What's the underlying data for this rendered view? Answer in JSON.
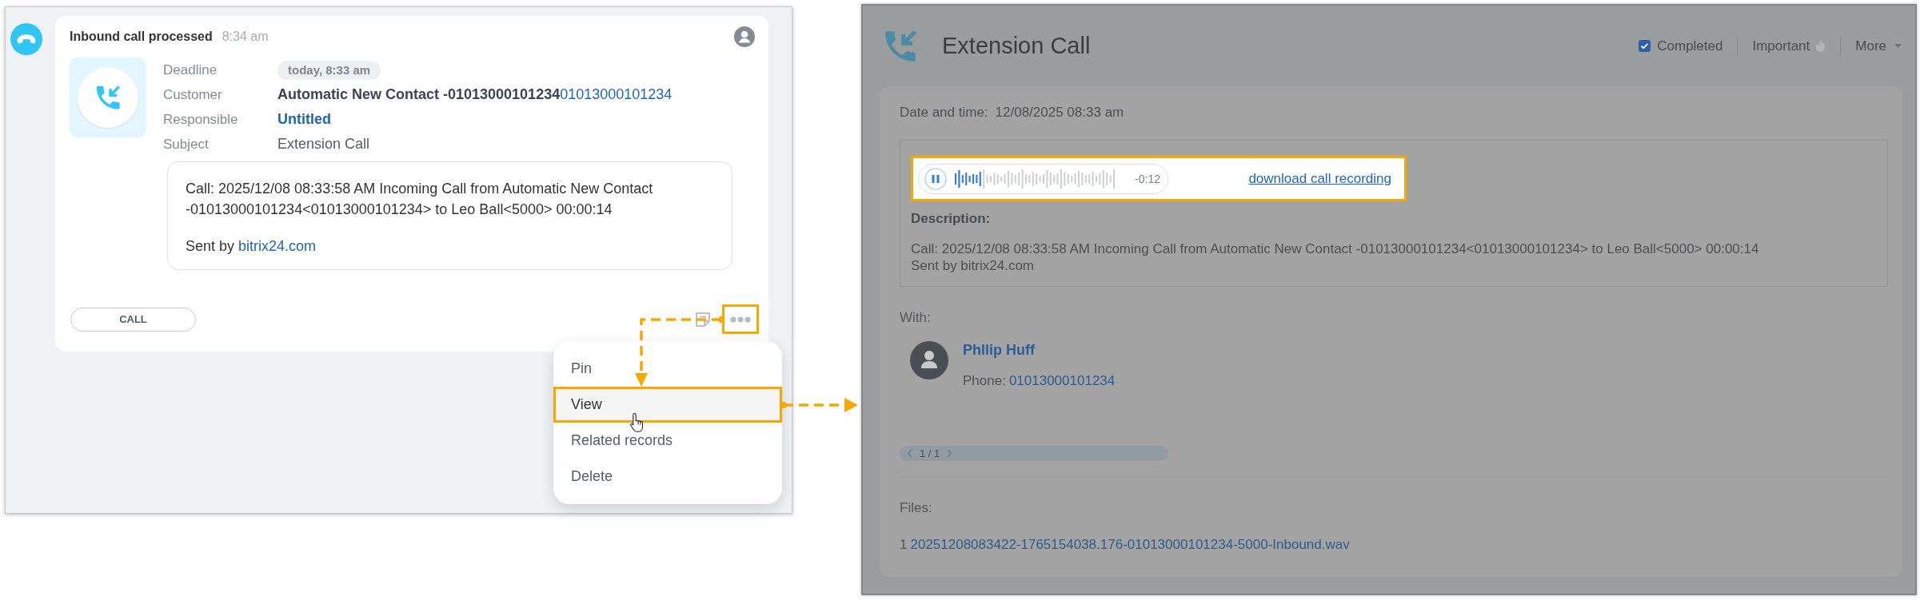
{
  "timeline_entry": {
    "title": "Inbound call processed",
    "time": "8:34 am",
    "fields": [
      {
        "kind": "badge",
        "label": "Deadline",
        "value": "today, 8:33 am"
      },
      {
        "kind": "contact",
        "label": "Customer",
        "value": "Automatic New Contact -01013000101234",
        "phone": "01013000101234"
      },
      {
        "kind": "link",
        "label": "Responsible",
        "value": "Untitled"
      },
      {
        "kind": "text",
        "label": "Subject",
        "value": "Extension Call"
      }
    ],
    "comment": {
      "text": "Call: 2025/12/08 08:33:58 AM Incoming Call from Automatic New Contact -01013000101234<01013000101234> to Leo Ball<5000> 00:00:14",
      "sent_by": "Sent by",
      "link": "bitrix24.com"
    },
    "call_button": "CALL"
  },
  "context_menu": {
    "items": [
      {
        "label": "Pin",
        "selected": false
      },
      {
        "label": "View",
        "selected": true
      },
      {
        "label": "Related records",
        "selected": false
      },
      {
        "label": "Delete",
        "selected": false
      }
    ]
  },
  "activity_window": {
    "title": "Extension Call",
    "completed": {
      "label": "Completed",
      "checked": true
    },
    "important": "Important",
    "more": "More",
    "date_label": "Date and time:",
    "date_value": "12/08/2025 08:33 am",
    "recording": {
      "playing": true,
      "level": 0.17,
      "time": "-0:12",
      "download_link": "download call recording"
    },
    "description_label": "Description:",
    "description": [
      "Call: 2025/12/08 08:33:58 AM Incoming Call from Automatic New Contact -01013000101234<01013000101234> to Leo Ball<5000> 00:00:14",
      "Sent by bitrix24.com"
    ],
    "with_label": "With:",
    "contact": {
      "name": "Phllip Huff",
      "phone_label": "Phone:",
      "phone": "01013000101234"
    },
    "pager": "1 / 1",
    "files_label": "Files:",
    "files": [
      {
        "index": "1",
        "name": "20251208083422-1765154038.176-01013000101234-5000-Inbound.wav"
      }
    ]
  }
}
